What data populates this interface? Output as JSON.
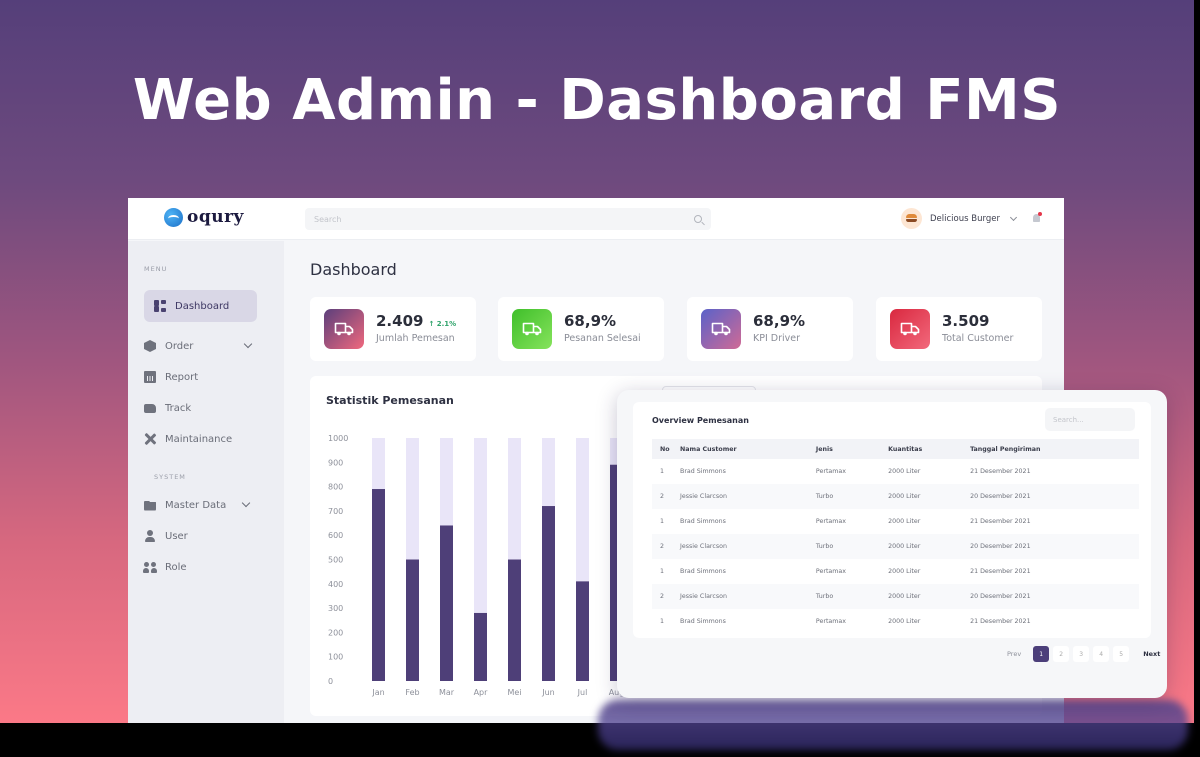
{
  "hero": {
    "title": "Web Admin - Dashboard FMS"
  },
  "topbar": {
    "logo_text": "oqury",
    "search_placeholder": "Search",
    "profile_name": "Delicious Burger"
  },
  "sidebar": {
    "menu_label": "MENU",
    "system_label": "SYSTEM",
    "items": [
      {
        "label": "Dashboard",
        "icon": "dashboard-icon",
        "active": true
      },
      {
        "label": "Order",
        "icon": "box-icon",
        "expandable": true
      },
      {
        "label": "Report",
        "icon": "report-icon"
      },
      {
        "label": "Track",
        "icon": "truck-icon"
      },
      {
        "label": "Maintainance",
        "icon": "tools-icon"
      },
      {
        "label": "Master Data",
        "icon": "folder-icon",
        "expandable": true
      },
      {
        "label": "User",
        "icon": "user-icon"
      },
      {
        "label": "Role",
        "icon": "users-icon"
      }
    ]
  },
  "page": {
    "title": "Dashboard"
  },
  "stats": [
    {
      "value": "2.409",
      "trend": "↑ 2.1%",
      "label": "Jumlah Pemesan",
      "color_from": "#5b3f7c",
      "color_to": "#f0687d"
    },
    {
      "value": "68,9%",
      "trend": "",
      "label": "Pesanan Selesai",
      "color_from": "#3fbf2a",
      "color_to": "#86e35c"
    },
    {
      "value": "68,9%",
      "trend": "",
      "label": "KPI Driver",
      "color_from": "#5a62c9",
      "color_to": "#d06a95"
    },
    {
      "value": "3.509",
      "trend": "",
      "label": "Total Customer",
      "color_from": "#d9283f",
      "color_to": "#f2697c"
    }
  ],
  "chart_data": {
    "type": "bar",
    "title": "Statistik Pemesanan",
    "categories": [
      "Jan",
      "Feb",
      "Mar",
      "Apr",
      "Mei",
      "Jun",
      "Jul",
      "Aug"
    ],
    "values": [
      790,
      500,
      640,
      280,
      500,
      720,
      410,
      890
    ],
    "background_max": 1000,
    "yticks": [
      0,
      100,
      200,
      300,
      400,
      500,
      600,
      700,
      800,
      900,
      1000
    ],
    "ylim": [
      0,
      1000
    ],
    "xlabel": "",
    "ylabel": "",
    "grid": false,
    "bar_color": "#4e3f78",
    "track_color": "#e9e5f8"
  },
  "overview": {
    "title": "Overview Pemesanan",
    "search_placeholder": "Search...",
    "columns": [
      "No",
      "Nama Customer",
      "Jenis",
      "Kuantitas",
      "Tanggal Pengiriman"
    ],
    "rows": [
      [
        "1",
        "Brad Simmons",
        "Pertamax",
        "2000 Liter",
        "21 Desember 2021"
      ],
      [
        "2",
        "Jessie Clarcson",
        "Turbo",
        "2000 Liter",
        "20 Desember 2021"
      ],
      [
        "1",
        "Brad Simmons",
        "Pertamax",
        "2000 Liter",
        "21 Desember 2021"
      ],
      [
        "2",
        "Jessie Clarcson",
        "Turbo",
        "2000 Liter",
        "20 Desember 2021"
      ],
      [
        "1",
        "Brad Simmons",
        "Pertamax",
        "2000 Liter",
        "21 Desember 2021"
      ],
      [
        "2",
        "Jessie Clarcson",
        "Turbo",
        "2000 Liter",
        "20 Desember 2021"
      ],
      [
        "1",
        "Brad Simmons",
        "Pertamax",
        "2000 Liter",
        "21 Desember 2021"
      ]
    ],
    "pagination": {
      "prev": "Prev",
      "next": "Next",
      "pages": [
        "1",
        "2",
        "3",
        "4",
        "5"
      ],
      "current": "1"
    }
  }
}
